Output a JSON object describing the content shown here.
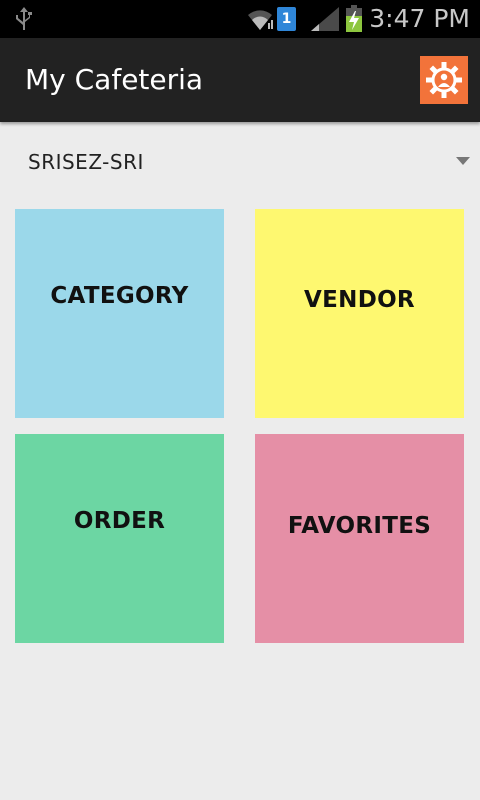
{
  "status_bar": {
    "sim_slot": "1",
    "time": "3:47 PM",
    "icons": [
      "usb-icon",
      "wifi-icon",
      "sim-badge",
      "signal-icon",
      "battery-charging-icon"
    ]
  },
  "action_bar": {
    "title": "My Cafeteria",
    "settings_icon": "settings-gear-icon",
    "settings_color": "#f2733a"
  },
  "spinner": {
    "selected": "SRISEZ-SRI"
  },
  "tiles": [
    {
      "label": "CATEGORY",
      "color": "#9bd8ea"
    },
    {
      "label": "VENDOR",
      "color": "#fef870"
    },
    {
      "label": "ORDER",
      "color": "#6cd6a3"
    },
    {
      "label": "FAVORITES",
      "color": "#e58fa6"
    }
  ]
}
